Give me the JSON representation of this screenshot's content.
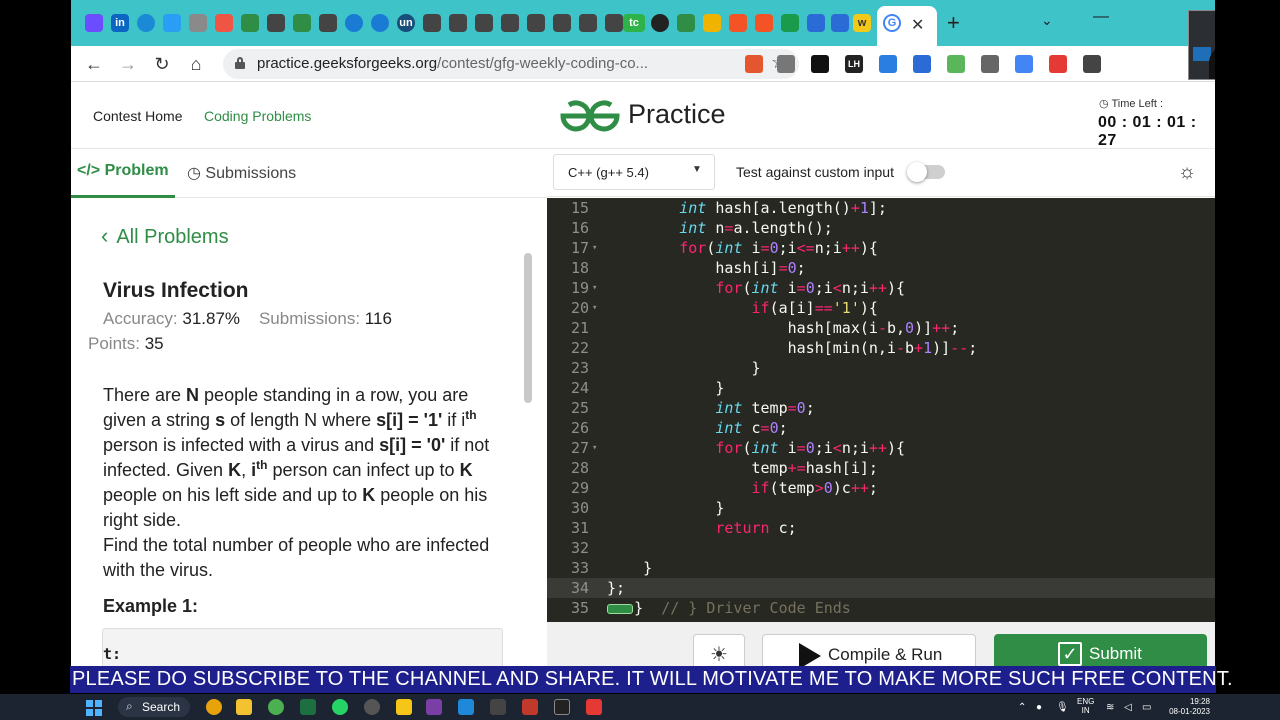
{
  "browser": {
    "url_host": "practice.geeksforgeeks.org",
    "url_path": "/contest/gfg-weekly-coding-co...",
    "new_tab_symbol": "+",
    "close_tab_symbol": "✕"
  },
  "header": {
    "contest_home": "Contest Home",
    "coding_problems": "Coding Problems",
    "brand": "Practice",
    "time_left_label": "Time Left :",
    "timer": "00 : 01 : 01 : 27"
  },
  "problem_tabs": {
    "problem": "Problem",
    "submissions": "Submissions"
  },
  "editor_toolbar": {
    "language": "C++ (g++ 5.4)",
    "custom_input_label": "Test against custom input"
  },
  "problem": {
    "back_label": "All Problems",
    "title": "Virus Infection",
    "accuracy_label": "Accuracy:",
    "accuracy": "31.87%",
    "submissions_label": "Submissions:",
    "submissions": "116",
    "points_label": "Points:",
    "points": "35",
    "example_title": "Example 1:",
    "example_snippet": "t:"
  },
  "editor": {
    "lines": [
      {
        "n": "15",
        "fold": ""
      },
      {
        "n": "16",
        "fold": ""
      },
      {
        "n": "17",
        "fold": "▾"
      },
      {
        "n": "18",
        "fold": ""
      },
      {
        "n": "19",
        "fold": "▾"
      },
      {
        "n": "20",
        "fold": "▾"
      },
      {
        "n": "21",
        "fold": ""
      },
      {
        "n": "22",
        "fold": ""
      },
      {
        "n": "23",
        "fold": ""
      },
      {
        "n": "24",
        "fold": ""
      },
      {
        "n": "25",
        "fold": ""
      },
      {
        "n": "26",
        "fold": ""
      },
      {
        "n": "27",
        "fold": "▾"
      },
      {
        "n": "28",
        "fold": ""
      },
      {
        "n": "29",
        "fold": ""
      },
      {
        "n": "30",
        "fold": ""
      },
      {
        "n": "31",
        "fold": ""
      },
      {
        "n": "32",
        "fold": ""
      },
      {
        "n": "33",
        "fold": ""
      },
      {
        "n": "34",
        "fold": ""
      },
      {
        "n": "35",
        "fold": ""
      }
    ],
    "last_comment": "// } Driver Code Ends"
  },
  "actions": {
    "compile": "Compile & Run",
    "submit": "Submit"
  },
  "banner": "PLEASE DO SUBSCRIBE TO THE CHANNEL AND SHARE. IT WILL MOTIVATE ME TO MAKE MORE SUCH FREE CONTENT.",
  "taskbar": {
    "search": "Search",
    "lang_top": "ENG",
    "lang_bottom": "IN",
    "time": "19:28",
    "date": "08-01-2023"
  },
  "colors": {
    "gfg_green": "#2f8d46",
    "editor_bg": "#272822",
    "tab_strip": "#3ec3c8",
    "banner": "#1d1f8c"
  }
}
